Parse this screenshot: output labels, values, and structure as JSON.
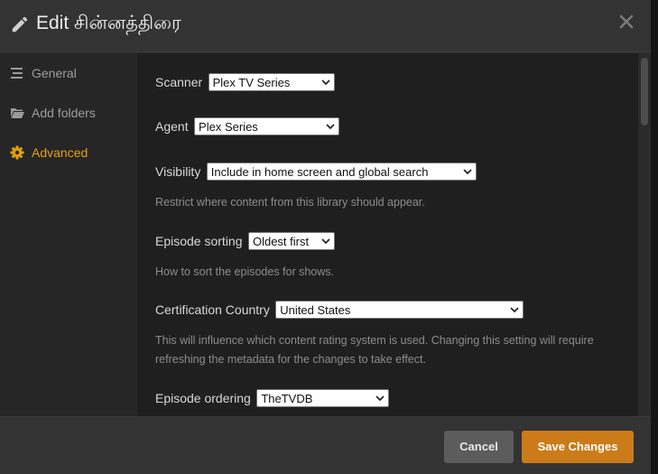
{
  "header": {
    "title": "Edit சின்னத்திரை"
  },
  "sidebar": {
    "items": [
      {
        "label": "General",
        "icon": "list-icon"
      },
      {
        "label": "Add folders",
        "icon": "folder-icon"
      },
      {
        "label": "Advanced",
        "icon": "gear-icon"
      }
    ],
    "active": "Advanced"
  },
  "settings": {
    "scanner": {
      "label": "Scanner",
      "value": "Plex TV Series"
    },
    "agent": {
      "label": "Agent",
      "value": "Plex Series"
    },
    "visibility": {
      "label": "Visibility",
      "value": "Include in home screen and global search",
      "help": "Restrict where content from this library should appear."
    },
    "episode_sorting": {
      "label": "Episode sorting",
      "value": "Oldest first",
      "help": "How to sort the episodes for shows."
    },
    "certification_country": {
      "label": "Certification Country",
      "value": "United States",
      "help": "This will influence which content rating system is used. Changing this setting will require refreshing the metadata for the changes to take effect."
    },
    "episode_ordering": {
      "label": "Episode ordering",
      "value": "TheTVDB"
    }
  },
  "footer": {
    "cancel_label": "Cancel",
    "save_label": "Save Changes"
  },
  "colors": {
    "accent": "#e5a00d",
    "save_button": "#cc7b19",
    "cancel_button": "#5c5c5c"
  }
}
